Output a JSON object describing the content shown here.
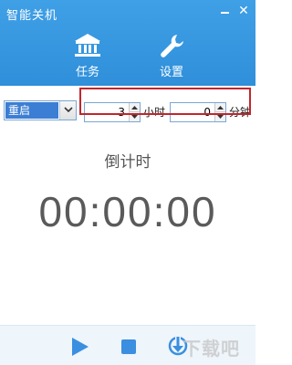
{
  "window": {
    "title": "智能关机"
  },
  "nav": {
    "task_label": "任务",
    "settings_label": "设置"
  },
  "controls": {
    "action": "重启",
    "hours_value": "3",
    "hours_unit": "小时",
    "minutes_value": "0",
    "minutes_unit": "分钟"
  },
  "countdown": {
    "label": "倒计时",
    "time": "00:00:00"
  },
  "watermark": "下载吧",
  "colors": {
    "header": "#3498e0",
    "select_highlight": "#3b7ed3",
    "annotation_box": "#c0262d",
    "footer_icon": "#3a8fe0"
  }
}
